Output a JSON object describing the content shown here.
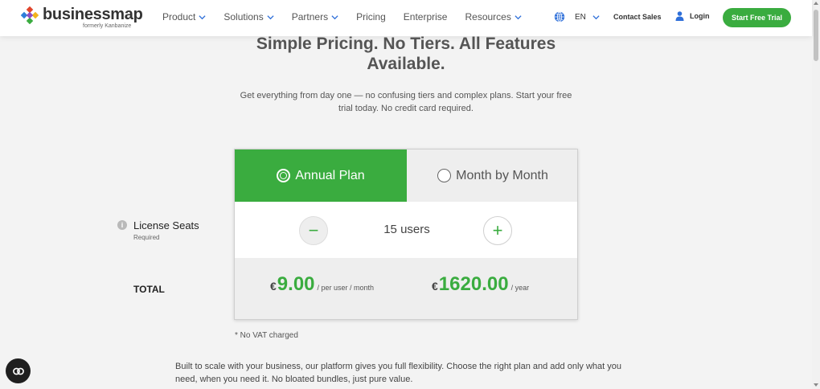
{
  "header": {
    "logo_text": "businessmap",
    "logo_subtext": "formerly Kanbanize",
    "nav": [
      {
        "label": "Product",
        "has_dropdown": true
      },
      {
        "label": "Solutions",
        "has_dropdown": true
      },
      {
        "label": "Partners",
        "has_dropdown": true
      },
      {
        "label": "Pricing",
        "has_dropdown": false
      },
      {
        "label": "Enterprise",
        "has_dropdown": false
      },
      {
        "label": "Resources",
        "has_dropdown": true
      }
    ],
    "language": "EN",
    "contact_label": "Contact Sales",
    "login_label": "Login",
    "cta_label": "Start Free Trial"
  },
  "hero": {
    "title": "Simple Pricing. No Tiers. All Features Available.",
    "subtitle": "Get everything from day one — no confusing tiers and complex plans. Start your free trial today. No credit card required."
  },
  "pricing": {
    "plans": [
      {
        "label": "Annual Plan",
        "selected": true
      },
      {
        "label": "Month by Month",
        "selected": false
      }
    ],
    "seats_label": "License Seats",
    "seats_required": "Required",
    "seats_value": "15 users",
    "minus_label": "−",
    "plus_label": "+",
    "total_label": "TOTAL",
    "currency": "€",
    "per_user_amount": "9.00",
    "per_user_unit": "/ per user / month",
    "yearly_amount": "1620.00",
    "yearly_unit": "/ year",
    "vat_note": "* No VAT charged"
  },
  "footer_text": "Built to scale with your business, our platform gives you full flexibility. Choose the right plan and add only what you need, when you need it. No bloated bundles, just pure value.",
  "colors": {
    "brand_green": "#3aac3f",
    "background": "#f3f3f3"
  },
  "icons": {
    "globe": "globe-icon",
    "user": "user-icon",
    "chevron": "chevron-down-icon",
    "info": "info-icon",
    "chat": "chat-icon"
  }
}
